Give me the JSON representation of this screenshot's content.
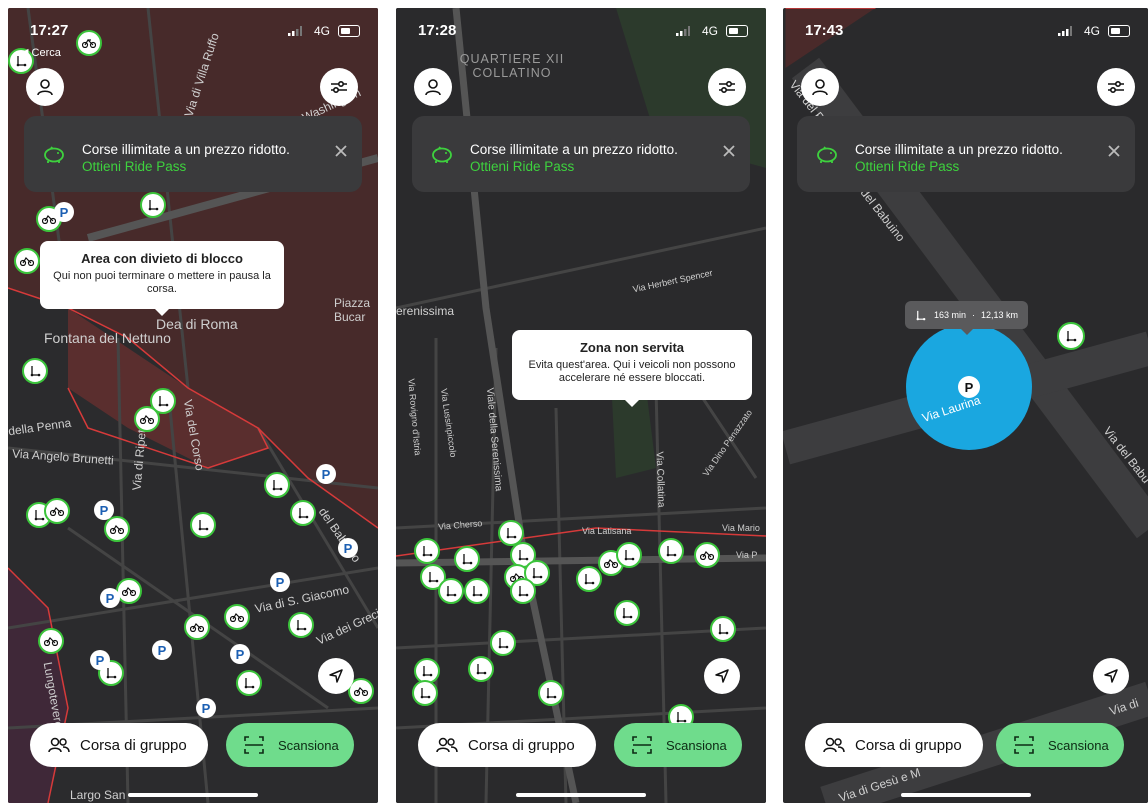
{
  "screens": [
    {
      "status": {
        "time": "17:27",
        "network": "4G",
        "back_label": "◀ Cerca"
      },
      "banner": {
        "text": "Corse illimitate a un prezzo ridotto.",
        "link": "Ottieni Ride Pass"
      },
      "tooltip": {
        "title": "Area con divieto di blocco",
        "body": "Qui non puoi terminare o mettere in pausa la corsa."
      },
      "map_labels": [
        "Fontana del Nettuno",
        "Dea di Roma",
        "Piazza Bucar",
        "Via Angelo Brunetti",
        "della Penna",
        "Lungotevere",
        "Largo San",
        "Via del Corso",
        "Via di Ripetta",
        "del Babuino",
        "Via di S. Giacomo",
        "Via dei Greci",
        "Via di Villa Ruffo",
        "Washington"
      ]
    },
    {
      "status": {
        "time": "17:28",
        "network": "4G"
      },
      "banner": {
        "text": "Corse illimitate a un prezzo ridotto.",
        "link": "Ottieni Ride Pass"
      },
      "tooltip": {
        "title": "Zona non servita",
        "body": "Evita quest'area. Qui i veicoli non possono accelerare né essere bloccati."
      },
      "map_labels": [
        "QUARTIERE XII COLLATINO",
        "erenissima",
        "Via Herbert Spencer",
        "Viale della Serenissima",
        "Via Lussinpiccolo",
        "Via Rovigno d'Istria",
        "Via Collatina",
        "Via Dino Penazzato",
        "Via Cherso",
        "Via Latisana",
        "Via Mario",
        "Via P"
      ]
    },
    {
      "status": {
        "time": "17:43",
        "network": "4G"
      },
      "banner": {
        "text": "Corse illimitate a un prezzo ridotto.",
        "link": "Ottieni Ride Pass"
      },
      "info_chip": {
        "duration": "163 min",
        "separator": "·",
        "distance": "12,13 km"
      },
      "parking_zone_label": "Via Laurina",
      "map_labels": [
        "del Babuino",
        "Via del P",
        "Via del Babu",
        "Via di Gesù e M",
        "Via di"
      ]
    }
  ],
  "buttons": {
    "group_ride": "Corsa di gruppo",
    "scan": "Scansiona"
  },
  "icons": {
    "profile": "profile-icon",
    "filter": "filter-sliders-icon",
    "piggy": "piggy-bank-icon",
    "close": "close-icon",
    "locate": "locate-arrow-icon",
    "scooter": "scooter-icon",
    "bike": "bike-icon",
    "parking": "parking-icon"
  },
  "colors": {
    "accent_green": "#3ed23e",
    "scan_button": "#6fdc8c",
    "banner_bg": "#3a3a3c",
    "zone_red": "#c0392b",
    "parking_blue": "#1aa7e0"
  }
}
